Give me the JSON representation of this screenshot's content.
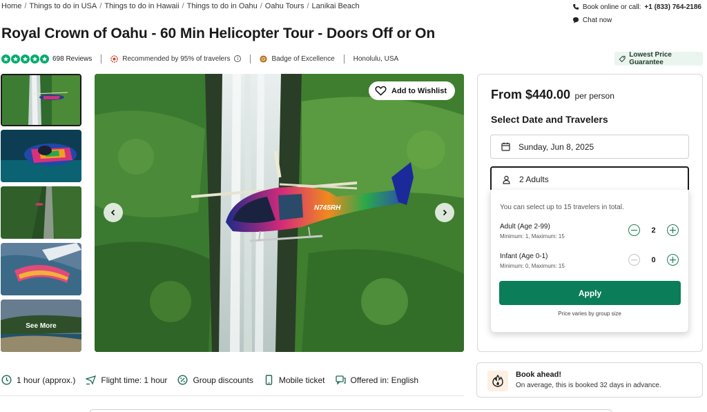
{
  "breadcrumb": [
    "Home",
    "Things to do in USA",
    "Things to do in Hawaii",
    "Things to do in Oahu",
    "Oahu Tours",
    "Lanikai Beach"
  ],
  "contact": {
    "book_label": "Book online or call:",
    "phone": "+1 (833) 764-2186",
    "chat_label": "Chat now"
  },
  "title": "Royal Crown of Oahu - 60 Min Helicopter Tour - Doors Off or On",
  "meta": {
    "rating_stars": 5,
    "reviews": "698 Reviews",
    "recommended": "Recommended by 95% of travelers",
    "badge": "Badge of Excellence",
    "location": "Honolulu, USA",
    "price_guarantee": "Lowest Price Guarantee"
  },
  "gallery": {
    "see_more": "See More"
  },
  "hero": {
    "wishlist_label": "Add to Wishlist",
    "helicopter_tail": "N745RH"
  },
  "booking": {
    "price": "From $440.00",
    "per": "per person",
    "section_title": "Select Date and Travelers",
    "date": "Sunday, Jun 8, 2025",
    "travelers": "2 Adults",
    "limit_note": "You can select up to 15 travelers in total.",
    "adult_label": "Adult (Age 2-99)",
    "adult_range": "Minimum: 1, Maximum: 15",
    "adult_count": "2",
    "infant_label": "Infant (Age 0-1)",
    "infant_range": "Minimum: 0, Maximum: 15",
    "infant_count": "0",
    "apply_label": "Apply",
    "price_note": "Price varies by group size"
  },
  "features": [
    "1 hour (approx.)",
    "Flight time: 1 hour",
    "Group discounts",
    "Mobile ticket",
    "Offered in: English"
  ],
  "book_ahead": {
    "title": "Book ahead!",
    "text": "On average, this is booked 32 days in advance."
  },
  "colors": {
    "brand_green": "#0b7d58",
    "rating_green": "#00aa6c",
    "stepper_green": "#1b7d54"
  }
}
